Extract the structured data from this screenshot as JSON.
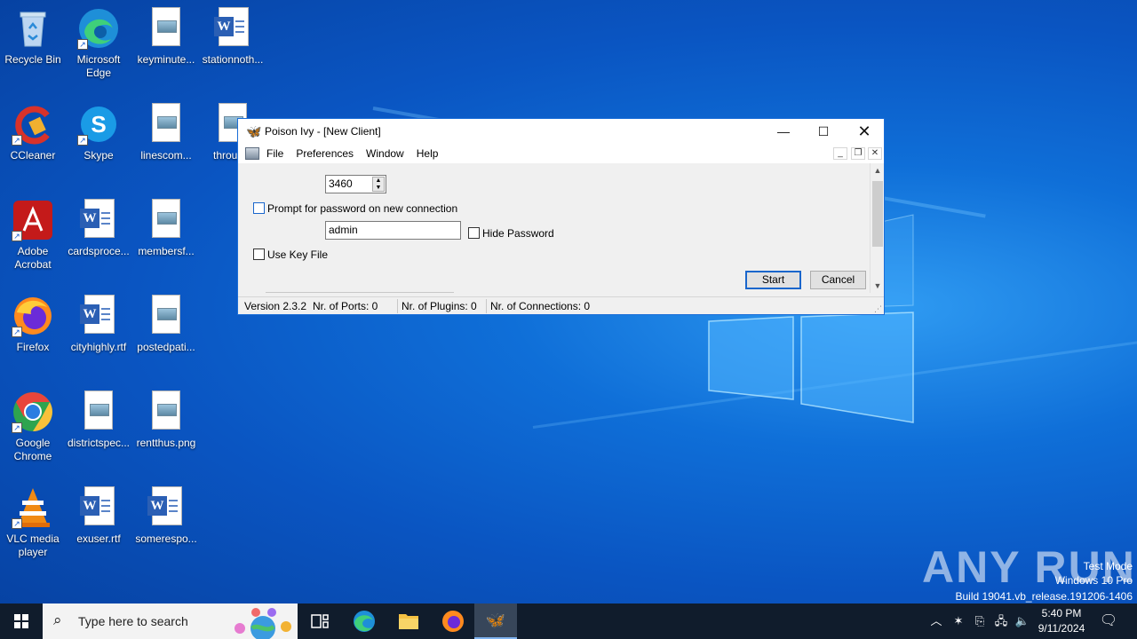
{
  "desktop": {
    "icons": [
      {
        "label": "Recycle Bin"
      },
      {
        "label": "Microsoft Edge"
      },
      {
        "label": "keyminute..."
      },
      {
        "label": "stationnoth..."
      },
      {
        "label": "CCleaner"
      },
      {
        "label": "Skype"
      },
      {
        "label": "linescom..."
      },
      {
        "label": "throug..."
      },
      {
        "label": "Adobe Acrobat"
      },
      {
        "label": "cardsproce..."
      },
      {
        "label": "membersf..."
      },
      {
        "label": "Firefox"
      },
      {
        "label": "cityhighly.rtf"
      },
      {
        "label": "postedpati..."
      },
      {
        "label": "Google Chrome"
      },
      {
        "label": "districtspec..."
      },
      {
        "label": "rentthus.png"
      },
      {
        "label": "VLC media player"
      },
      {
        "label": "exuser.rtf"
      },
      {
        "label": "somerespo..."
      }
    ]
  },
  "window": {
    "title": "Poison Ivy - [New Client]",
    "menu": [
      "File",
      "Preferences",
      "Window",
      "Help"
    ],
    "port_value": "3460",
    "prompt_password_label": "Prompt for password on new connection",
    "password_value": "admin",
    "hide_password_label": "Hide Password",
    "use_key_file_label": "Use Key File",
    "start_label": "Start",
    "cancel_label": "Cancel",
    "status": {
      "version": "Version 2.3.2",
      "ports": "Nr. of Ports: 0",
      "plugins": "Nr. of Plugins: 0",
      "connections": "Nr. of Connections: 0"
    }
  },
  "watermark": {
    "brand": "ANY RUN",
    "test_mode": "Test Mode",
    "os": "Windows 10 Pro",
    "build": "Build 19041.vb_release.191206-1406"
  },
  "taskbar": {
    "search_placeholder": "Type here to search",
    "time": "5:40 PM",
    "date": "9/11/2024"
  },
  "colors": {
    "accent": "#1a66cc",
    "taskbar": "#101c2c"
  }
}
